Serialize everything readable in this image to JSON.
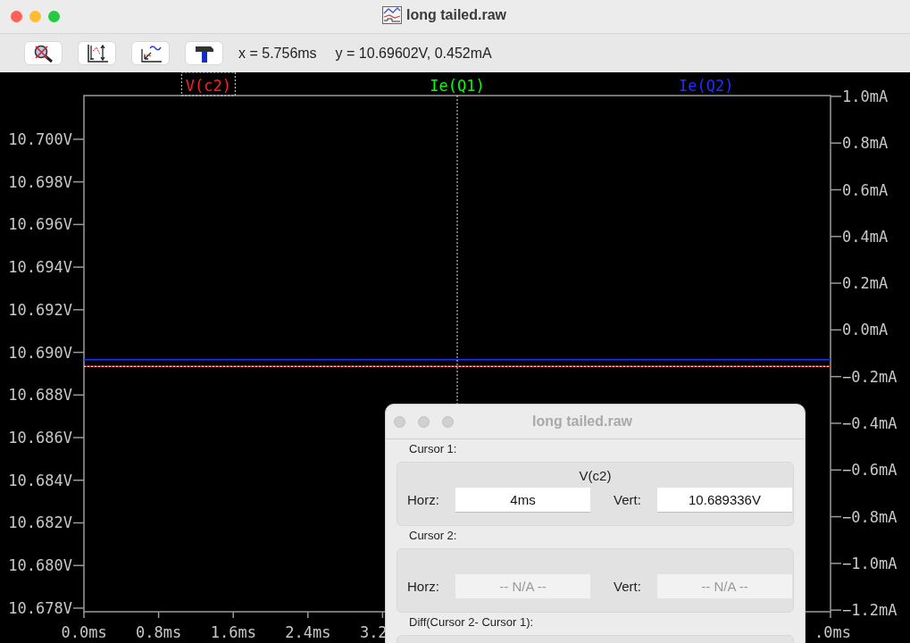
{
  "window": {
    "title": "long tailed.raw"
  },
  "toolbar": {
    "readout_x": "x = 5.756ms",
    "readout_y": "y = 10.69602V, 0.452mA"
  },
  "plot": {
    "chart_data": {
      "type": "line",
      "x": [
        0,
        8
      ],
      "xlim": [
        0,
        8
      ],
      "ylim": [
        10.67783,
        10.70205
      ],
      "xticks": [
        {
          "value": 0,
          "label": "0.0ms"
        },
        {
          "value": 0.8,
          "label": "0.8ms"
        },
        {
          "value": 1.6,
          "label": "1.6ms"
        },
        {
          "value": 2.4,
          "label": "2.4ms"
        },
        {
          "value": 3.2,
          "label": "3.2"
        }
      ],
      "ref_lines": [
        {
          "axis": "x",
          "value": 4
        }
      ],
      "yticks": [
        {
          "value": 10.678,
          "label": "10.678V"
        },
        {
          "value": 10.68,
          "label": "10.680V"
        },
        {
          "value": 10.682,
          "label": "10.682V"
        },
        {
          "value": 10.684,
          "label": "10.684V"
        },
        {
          "value": 10.686,
          "label": "10.686V"
        },
        {
          "value": 10.688,
          "label": "10.688V"
        },
        {
          "value": 10.69,
          "label": "10.690V"
        },
        {
          "value": 10.692,
          "label": "10.692V"
        },
        {
          "value": 10.694,
          "label": "10.694V"
        },
        {
          "value": 10.696,
          "label": "10.696V"
        },
        {
          "value": 10.698,
          "label": "10.698V"
        },
        {
          "value": 10.7,
          "label": "10.700V"
        }
      ],
      "series": [
        {
          "name": "V(c2)",
          "color": "#ff2020",
          "values": [
            10.68934,
            10.68934
          ]
        },
        {
          "name": "Ie(Q1)",
          "color": "#00ff00",
          "values": [
            null,
            null
          ]
        },
        {
          "name": "Ie(Q2)",
          "color": "#2030ff",
          "values": [
            10.68966,
            10.68966
          ]
        }
      ]
    },
    "legend": [
      {
        "selected": true
      },
      {
        "selected": false
      },
      {
        "selected": false
      }
    ],
    "x_end_label": ".0ms",
    "right_axis": {
      "labels": [
        "1.0mA",
        "0.8mA",
        "0.6mA",
        "0.4mA",
        "0.2mA",
        "0.0mA",
        "−0.2mA",
        "−0.4mA",
        "−0.6mA",
        "−0.8mA",
        "−1.0mA",
        "−1.2mA"
      ]
    }
  },
  "cursor_dialog": {
    "title": "long tailed.raw",
    "sections": [
      {
        "label": "Cursor 1:",
        "trace": "V(c2)",
        "horz_label": "Horz:",
        "horz": "4ms",
        "vert_label": "Vert:",
        "vert": "10.689336V",
        "disabled": false
      },
      {
        "label": "Cursor 2:",
        "horz_label": "Horz:",
        "horz": "-- N/A --",
        "vert_label": "Vert:",
        "vert": "-- N/A --",
        "disabled": true
      }
    ],
    "diff_label": "Diff(Cursor 2- Cursor 1):"
  }
}
